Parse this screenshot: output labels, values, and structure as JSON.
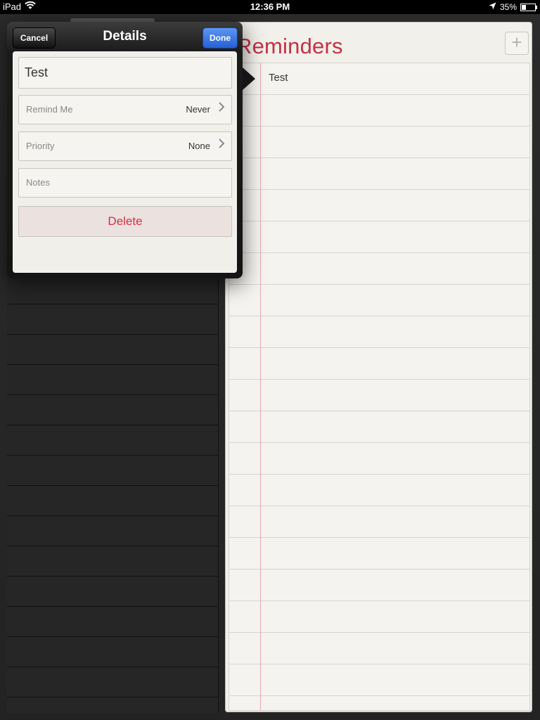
{
  "status_bar": {
    "device": "iPad",
    "time": "12:36 PM",
    "battery": "35%"
  },
  "popover": {
    "title": "Details",
    "cancel_label": "Cancel",
    "done_label": "Done",
    "reminder_title": "Test",
    "rows": [
      {
        "label": "Remind Me",
        "value": "Never"
      },
      {
        "label": "Priority",
        "value": "None"
      }
    ],
    "notes_placeholder": "Notes",
    "delete_label": "Delete"
  },
  "reminders": {
    "title": "Reminders",
    "add_symbol": "+",
    "items": [
      "Test"
    ]
  },
  "colors": {
    "accent_red": "#c23245",
    "done_blue": "#2f6fe0",
    "delete_red": "#d33243"
  },
  "icons": {
    "wifi": "wifi-icon",
    "location": "location-arrow-icon",
    "battery": "battery-icon",
    "chevron": "chevron-right-icon"
  }
}
